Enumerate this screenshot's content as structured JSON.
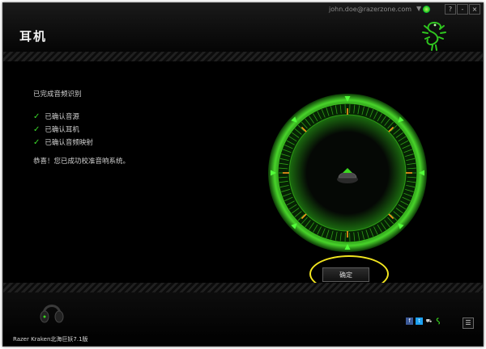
{
  "header": {
    "app_title": "耳机",
    "account_email": "john.doe@razerzone.com",
    "account_menu_icon": "chevron-down-icon",
    "status_icon": "online-status-icon",
    "help_label": "?",
    "minimize_label": "-",
    "close_label": "×"
  },
  "calibration": {
    "section_title": "已完成音频识别",
    "steps": [
      {
        "label": "已确认音源",
        "icon": "checkmark-icon"
      },
      {
        "label": "已确认耳机",
        "icon": "checkmark-icon"
      },
      {
        "label": "已确认音频映射",
        "icon": "checkmark-icon"
      }
    ],
    "congrats_message": "恭喜！您已成功校准音响系统。",
    "ok_label": "确定"
  },
  "footer": {
    "device_name": "Razer Kraken北海巨妖7.1版",
    "social_icons": [
      "facebook-icon",
      "twitter-icon",
      "cart-icon",
      "razer-icon"
    ],
    "menu_icon": "menu-icon"
  },
  "colors": {
    "accent_green": "#44d62c",
    "tick_orange": "#ff9a1a",
    "highlight_yellow": "#f2e51f"
  }
}
